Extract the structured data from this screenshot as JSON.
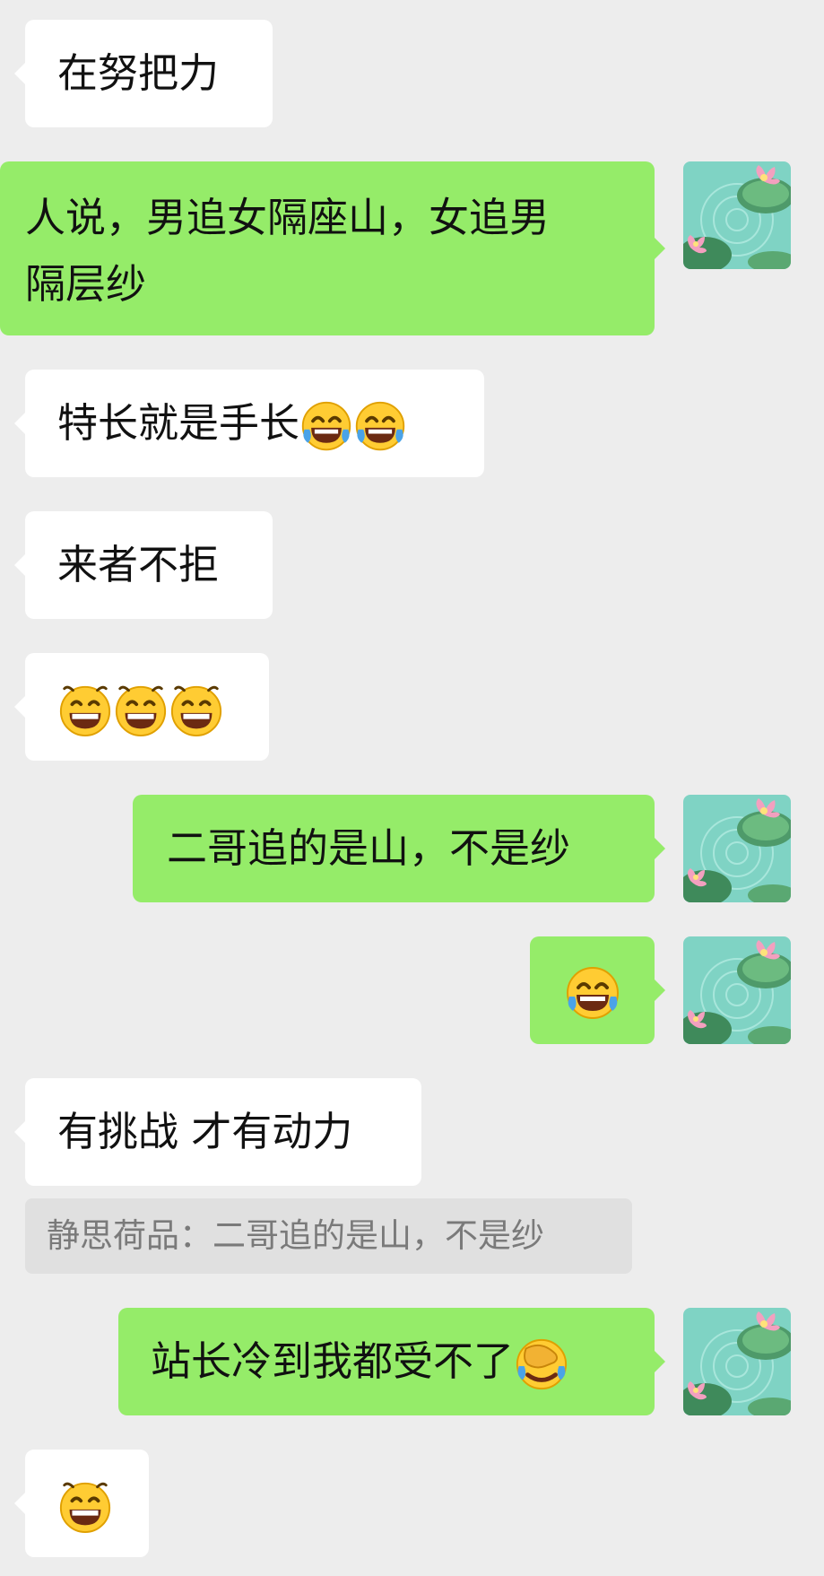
{
  "messages": [
    {
      "text": "在努把力"
    },
    {
      "line1": "人说，男追女隔座山，女追男",
      "line2": "隔层纱"
    },
    {
      "text": "特长就是手长",
      "emoji": [
        "face-with-tears-of-joy",
        "face-with-tears-of-joy"
      ]
    },
    {
      "text": "来者不拒"
    },
    {
      "emoji": [
        "grinning-face",
        "grinning-face",
        "grinning-face"
      ]
    },
    {
      "text": "二哥追的是山，不是纱"
    },
    {
      "emoji": [
        "face-with-tears-of-joy"
      ]
    },
    {
      "text": "有挑战 才有动力"
    },
    {
      "quote": "静思荷品：二哥追的是山，不是纱"
    },
    {
      "text": "站长冷到我都受不了",
      "emoji": [
        "face-palm"
      ]
    },
    {
      "emoji": [
        "grinning-face"
      ]
    }
  ],
  "colors": {
    "background": "#ededed",
    "incoming_bubble": "#ffffff",
    "outgoing_bubble": "#95ec69",
    "quote_bg": "#e0e0e0",
    "quote_text": "#7a7a7a"
  },
  "avatar_icon": "lotus-pond-avatar-icon"
}
